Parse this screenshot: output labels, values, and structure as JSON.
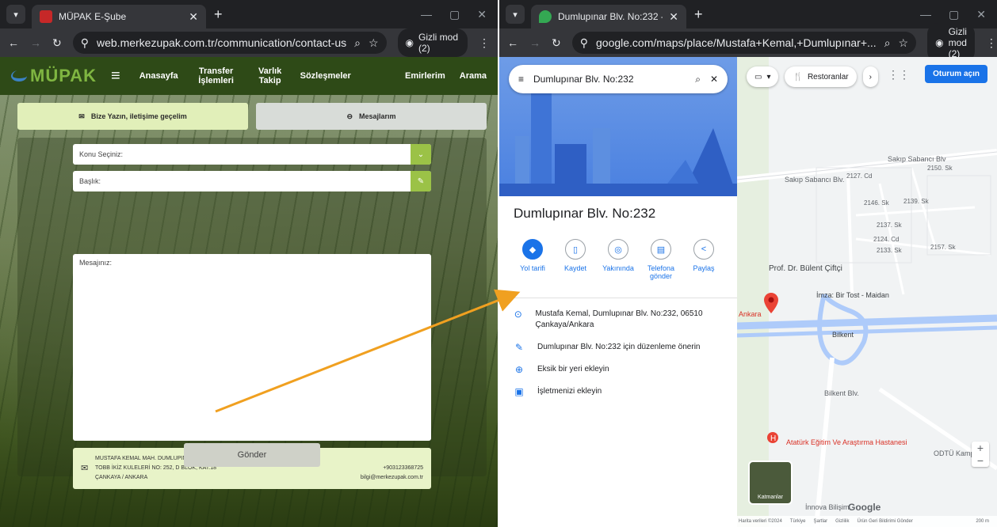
{
  "left_browser": {
    "tab_title": "MÜPAK E-Şube",
    "url": "web.merkezupak.com.tr/communication/contact-us",
    "incognito_label": "Gizli mod (2)"
  },
  "site": {
    "logo_text": "MÜPAK",
    "nav": [
      "Anasayfa",
      "Transfer İşlemleri",
      "Varlık Takip",
      "Sözleşmeler",
      "Emirlerim",
      "Arama"
    ],
    "tab_write": "Bize Yazın, iletişime geçelim",
    "tab_messages": "Mesajlarım",
    "topic_placeholder": "Konu Seçiniz:",
    "title_placeholder": "Başlık:",
    "message_placeholder": "Mesajınız:",
    "address_line1": "MUSTAFA KEMAL MAH. DUMLUPINAR BUL.",
    "address_line2": "TOBB İKİZ KULELERİ NO: 252, D BLOK, KAT:18",
    "address_line3": "ÇANKAYA / ANKARA",
    "phone": "+903123368725",
    "email": "bilgi@merkezupak.com.tr",
    "send_label": "Gönder"
  },
  "right_browser": {
    "tab_title": "Dumlupınar Blv. No:232 - Goog",
    "url": "google.com/maps/place/Mustafa+Kemal,+Dumlupınar+...",
    "incognito_label": "Gizli mod (2)"
  },
  "maps": {
    "search_query": "Dumlupınar Blv. No:232",
    "place_title": "Dumlupınar Blv. No:232",
    "actions": [
      "Yol tarifi",
      "Kaydet",
      "Yakınında",
      "Telefona gönder",
      "Paylaş"
    ],
    "address": "Mustafa Kemal, Dumlupınar Blv. No:232, 06510 Çankaya/Ankara",
    "suggest_edit": "Dumlupınar Blv. No:232 için düzenleme önerin",
    "add_place": "Eksik bir yeri ekleyin",
    "add_business": "İşletmenizi ekleyin",
    "chip_restaurants": "Restoranlar",
    "signin": "Oturum açın",
    "layers_label": "Katmanlar",
    "map_labels": [
      "Sakıp Sabancı Blv.",
      "Sakıp Sabancı Blv",
      "Prof. Dr. Bülent Çiftçi",
      "İmza: Bir Tost - Maidan",
      "Bilkent",
      "Atatürk Eğitim Ve Araştırma Hastanesi",
      "ODTÜ Kampüsü",
      "Ankara",
      "Bilkent Blv.",
      "İnnova Bilişim",
      "2127. Cd",
      "2146. Sk",
      "2139. Sk",
      "2137. Sk",
      "2124. Cd",
      "2133. Sk",
      "2157. Sk",
      "2150. Sk"
    ],
    "footer": [
      "Harita verileri ©2024",
      "Türkiye",
      "Şartlar",
      "Gizlilik",
      "Ürün Geri Bildirimi Gönder",
      "200 m"
    ],
    "google_logo": "Google"
  }
}
